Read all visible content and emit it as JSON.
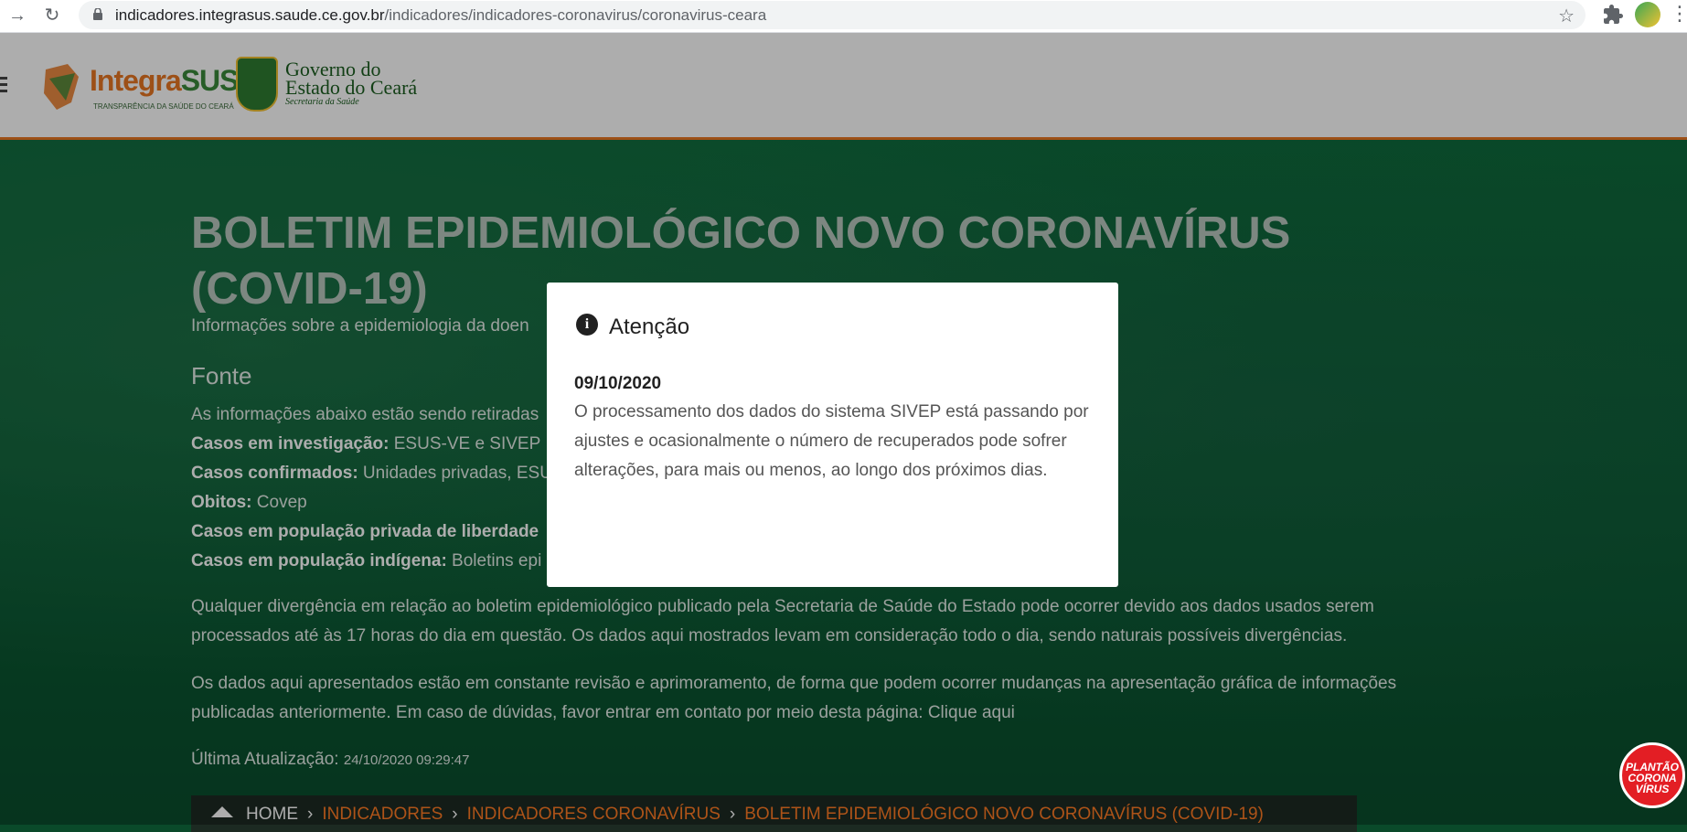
{
  "browser": {
    "url_domain": "indicadores.integrasus.saude.ce.gov.br",
    "url_path": "/indicadores/indicadores-coronavirus/coronavirus-ceara"
  },
  "header": {
    "logo_integra_1": "Integra",
    "logo_integra_2": "SUS",
    "logo_integra_tagline": "TRANSPARÊNCIA DA SAÚDE DO CEARÁ",
    "gov_line1": "Governo do",
    "gov_line2": "Estado do Ceará",
    "gov_line3": "Secretaria da Saúde"
  },
  "hero": {
    "title": "BOLETIM EPIDEMIOLÓGICO NOVO CORONAVÍRUS (COVID-19)",
    "subtitle": "Informações sobre a epidemiologia da doen",
    "fonte_heading": "Fonte",
    "fonte_intro": "As informações abaixo estão sendo retiradas",
    "sources": [
      {
        "label": "Casos em investigação:",
        "value": " ESUS-VE e SIVEP"
      },
      {
        "label": "Casos confirmados:",
        "value": " Unidades privadas, ESU"
      },
      {
        "label": "Obitos:",
        "value": " Covep"
      },
      {
        "label": "Casos em população privada de liberdade",
        "value": ""
      },
      {
        "label": "Casos em população indígena:",
        "value": " Boletins epi"
      }
    ],
    "paragraph1": "Qualquer divergência em relação ao boletim epidemiológico publicado pela Secretaria de Saúde do Estado pode ocorrer devido aos dados usados serem processados até às 17 horas do dia em questão. Os dados aqui mostrados levam em consideração todo o dia, sendo naturais possíveis divergências.",
    "paragraph2": "Os dados aqui apresentados estão em constante revisão e aprimoramento, de forma que podem ocorrer mudanças na apresentação gráfica de informações publicadas anteriormente. Em caso de dúvidas, favor entrar em contato por meio desta página: Clique aqui",
    "last_update_label": "Última Atualização:",
    "last_update_value": "24/10/2020 09:29:47"
  },
  "breadcrumb": {
    "home": "HOME",
    "items": [
      "INDICADORES",
      "INDICADORES CORONAVÍRUS",
      "BOLETIM EPIDEMIOLÓGICO NOVO CORONAVÍRUS (COVID-19)"
    ]
  },
  "modal": {
    "title": "Atenção",
    "date": "09/10/2020",
    "body": "O processamento dos dados do sistema SIVEP está passando por ajustes e ocasionalmente o número de recuperados pode sofrer alterações, para mais ou menos, ao longo dos próximos dias."
  },
  "badge": {
    "line1": "PLANTÃO",
    "line2": "CORONA",
    "line3": "VÍRUS"
  }
}
